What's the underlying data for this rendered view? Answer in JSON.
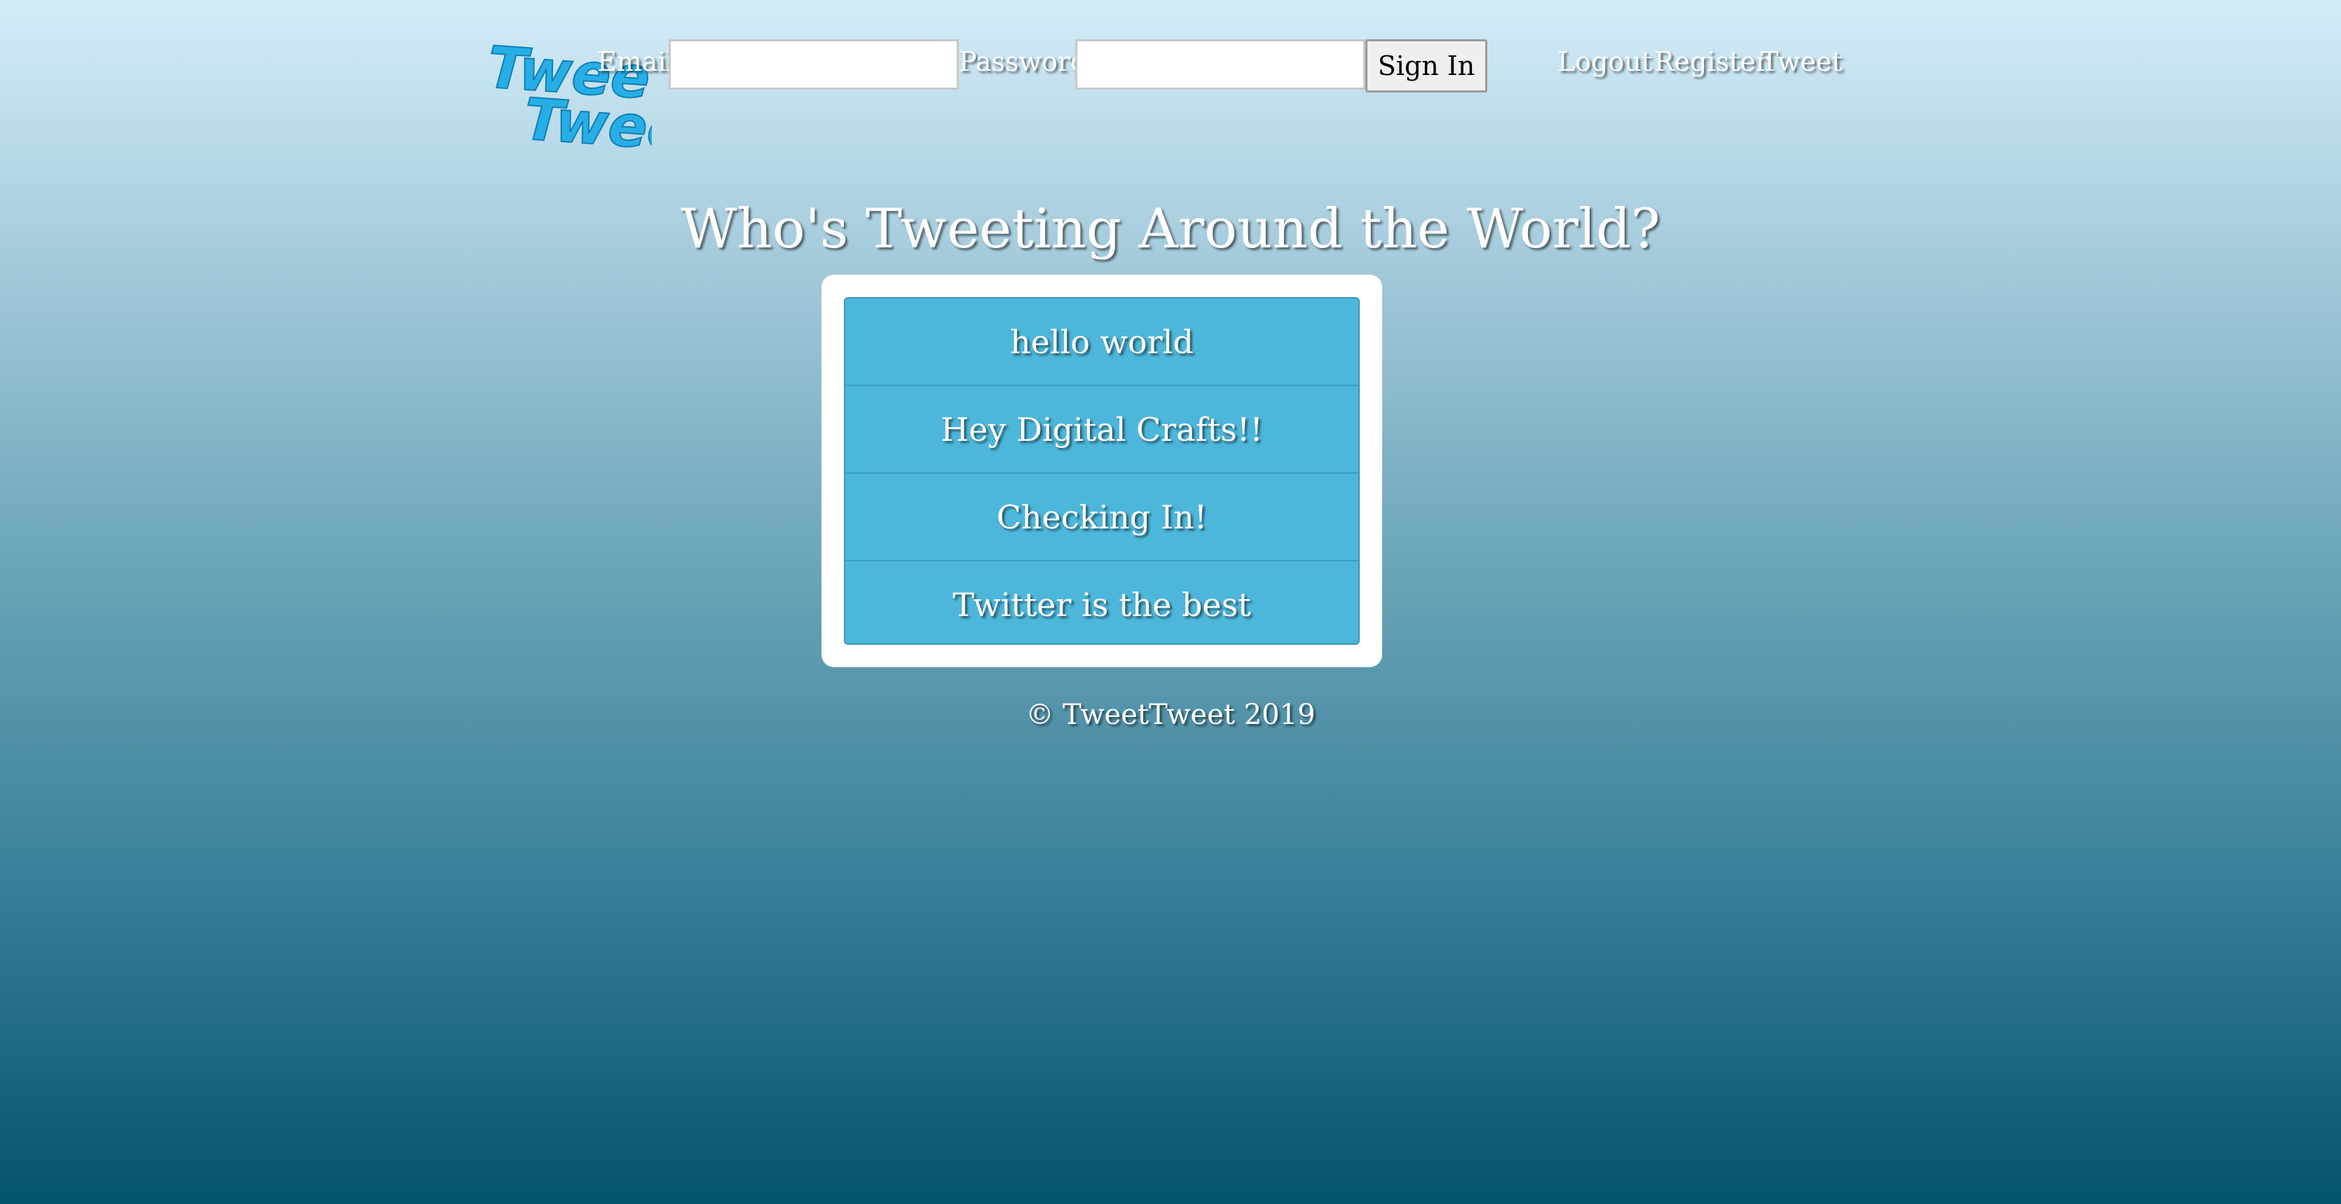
{
  "header": {
    "logo": {
      "line1": "Tweet",
      "line2": "Tweet",
      "color": "#27aee6"
    },
    "login": {
      "email_label": "Email:",
      "email_value": "",
      "password_label": "Password:",
      "password_value": "",
      "signin_label": "Sign In"
    },
    "nav": {
      "logout": "Logout",
      "register": "Register",
      "tweet": "Tweet"
    }
  },
  "main": {
    "title": "Who's Tweeting Around the World?",
    "tweets": [
      "hello world",
      "Hey Digital Crafts!!",
      "Checking In!",
      "Twitter is the best"
    ]
  },
  "footer": {
    "text": "© TweetTweet 2019"
  },
  "colors": {
    "tweet_background": "#4db7db",
    "gradient_top": "#d3ecf8",
    "gradient_bottom": "#04536e"
  }
}
